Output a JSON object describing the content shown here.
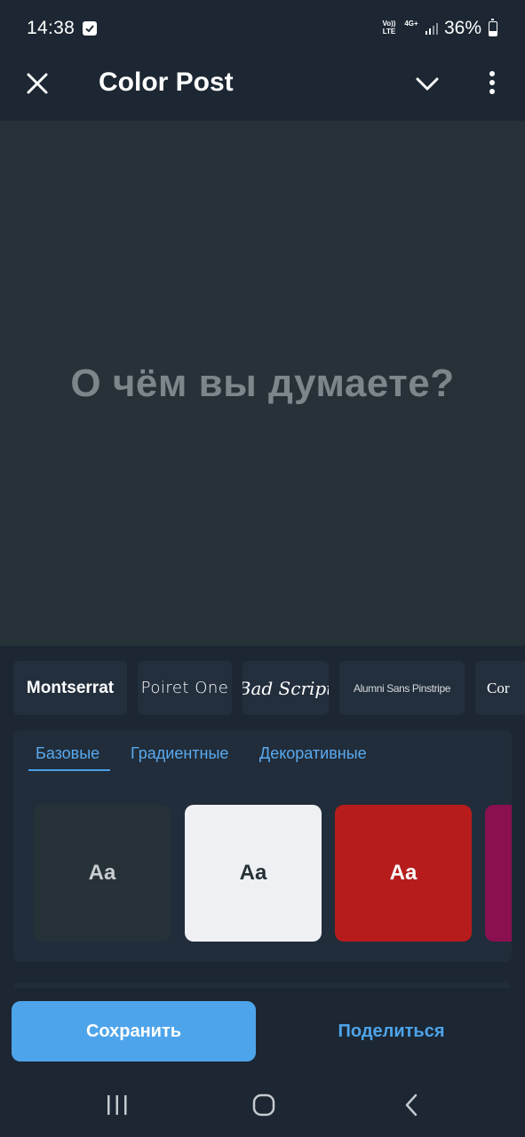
{
  "status_bar": {
    "time": "14:38",
    "volte": "Vo))\nLTE",
    "network": "4G+",
    "battery": "36%",
    "battery_level": 0.36
  },
  "app_bar": {
    "title": "Color Post"
  },
  "canvas": {
    "placeholder": "О чём вы думаете?"
  },
  "fonts": [
    "Montserrat",
    "Poiret One",
    "Bad Script",
    "Alumni Sans Pinstripe",
    "Cor"
  ],
  "color_panel": {
    "tabs": [
      "Базовые",
      "Градиентные",
      "Декоративные"
    ],
    "active_tab": "Базовые",
    "swatches": [
      {
        "label": "Aa",
        "background": "#263238",
        "text_color": "#c8cdd0"
      },
      {
        "label": "Aa",
        "background": "#eef0f3",
        "text_color": "#263238"
      },
      {
        "label": "Aa",
        "background": "#b71c1c",
        "text_color": "#ffffff"
      },
      {
        "label": "",
        "background": "#8a1050",
        "text_color": "#ffffff"
      }
    ]
  },
  "actions": {
    "save": "Сохранить",
    "share": "Поделиться"
  },
  "colors": {
    "background": "#1c2733",
    "canvas": "#263238",
    "accent": "#4ea4ea",
    "panel": "#212d3a"
  },
  "icons": {
    "close": "close-icon",
    "chevron": "chevron-down-icon",
    "more": "more-vert-icon",
    "nav_recent": "recent-apps-icon",
    "nav_home": "home-icon",
    "nav_back": "back-icon"
  }
}
